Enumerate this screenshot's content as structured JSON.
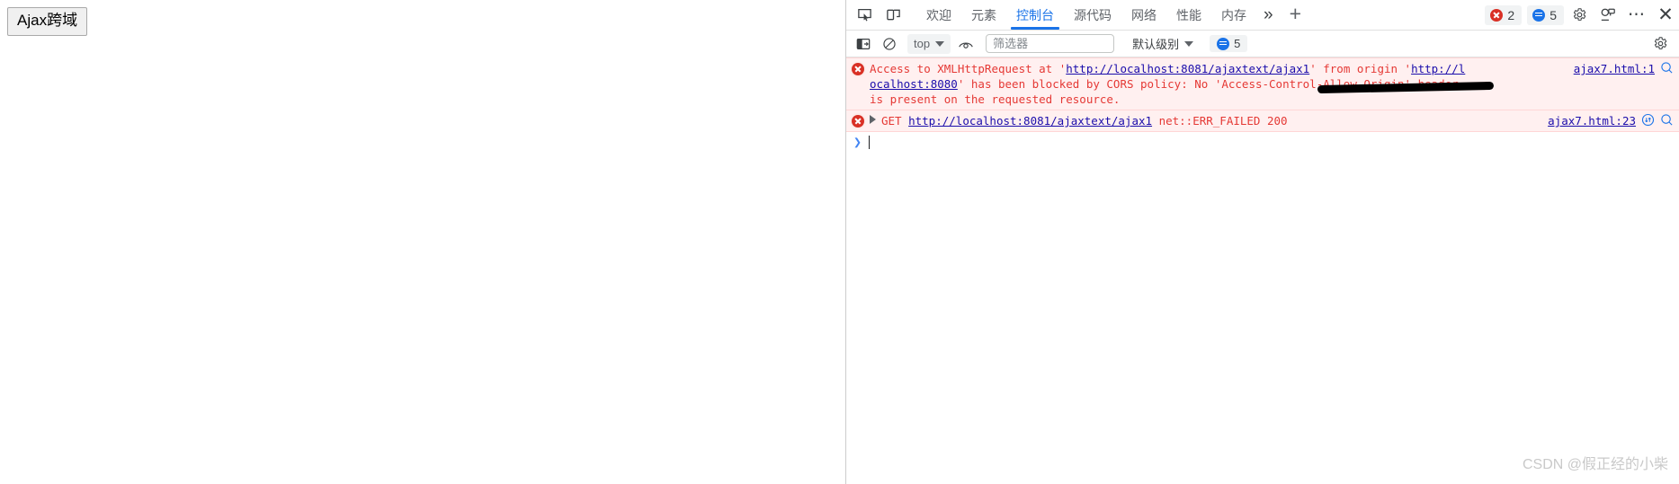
{
  "webpage": {
    "button_label": "Ajax跨域"
  },
  "devtools": {
    "tabbar": {
      "inspect_icon": "inspect-element-icon",
      "device_icon": "device-toolbar-icon",
      "tabs": [
        {
          "label": "欢迎",
          "active": false
        },
        {
          "label": "元素",
          "active": false
        },
        {
          "label": "控制台",
          "active": true
        },
        {
          "label": "源代码",
          "active": false
        },
        {
          "label": "网络",
          "active": false
        },
        {
          "label": "性能",
          "active": false
        },
        {
          "label": "内存",
          "active": false
        }
      ],
      "more_tabs_label": "»",
      "add_tab_label": "+",
      "error_count": "2",
      "info_count": "5",
      "settings_icon": "gear-icon",
      "customize_icon": "devtools-customize-icon",
      "more_options_label": "⋯",
      "close_label": "✕"
    },
    "consolebar": {
      "sidebar_icon": "console-sidebar-icon",
      "clear_icon": "clear-console-icon",
      "context": "top",
      "eye_icon": "live-expression-icon",
      "filter_placeholder": "筛选器",
      "filter_value": "",
      "level": "默认级别",
      "issues_count": "5",
      "settings_icon": "gear-icon"
    },
    "messages": [
      {
        "id": "cors-error",
        "icon": "error-icon",
        "parts": [
          {
            "t": "Access to XMLHttpRequest at ",
            "link": false
          },
          {
            "t": "'",
            "link": false
          },
          {
            "t": "http://localhost:8081/ajaxtext/ajax1",
            "link": true
          },
          {
            "t": "' from origin ",
            "link": false
          },
          {
            "t": "'",
            "link": false
          },
          {
            "t": "http://l",
            "link": true
          }
        ],
        "line2_parts": [
          {
            "t": "ocalhost:8080",
            "link": true
          },
          {
            "t": "' has been blocked by CORS policy: No 'Access-Control-Allow-Origin' header",
            "link": false
          }
        ],
        "line3": "is present on the requested resource.",
        "source": "ajax7.html:1",
        "right_icons": [
          "search-icon"
        ]
      },
      {
        "id": "get-failed",
        "icon": "error-icon",
        "expandable": true,
        "method": "GET",
        "url": "http://localhost:8081/ajaxtext/ajax1",
        "status": "net::ERR_FAILED 200",
        "source": "ajax7.html:23",
        "right_icons": [
          "network-request-icon",
          "search-icon"
        ]
      }
    ],
    "prompt": {
      "caret": "❯",
      "value": ""
    }
  },
  "annotations": {
    "arrow_color": "#f5221f",
    "redaction_color": "#000000"
  },
  "watermark": {
    "text": "CSDN @假正经的小柴"
  }
}
